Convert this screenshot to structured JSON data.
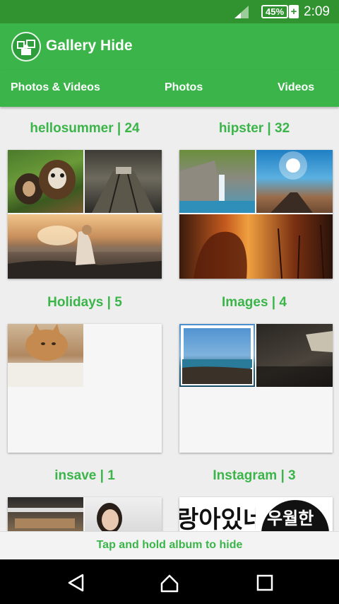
{
  "status_bar": {
    "battery_percent": "45%",
    "charging_symbol": "+",
    "time": "2:09",
    "icons": [
      "signal-icon",
      "battery-icon"
    ]
  },
  "app_bar": {
    "title": "Gallery Hide",
    "logo_icon": "app-logo-icon"
  },
  "tabs": [
    {
      "label": "Photos & Videos"
    },
    {
      "label": "Photos"
    },
    {
      "label": "Videos"
    }
  ],
  "albums": [
    {
      "label": "hellosummer | 24"
    },
    {
      "label": "hipster | 32"
    },
    {
      "label": "Holidays | 5"
    },
    {
      "label": "Images | 4"
    },
    {
      "label": "insave | 1"
    },
    {
      "label": "Instagram | 3"
    }
  ],
  "instagram_thumb_text": {
    "left": "랑아있네",
    "right": "우월한"
  },
  "hint": "Tap and hold album to hide",
  "nav_bar": {
    "icons": [
      "back-icon",
      "home-icon",
      "recents-icon"
    ]
  },
  "colors": {
    "status_bar": "#31932f",
    "accent": "#3bb54a",
    "label": "#3bb54a",
    "background": "#eeeeee"
  }
}
